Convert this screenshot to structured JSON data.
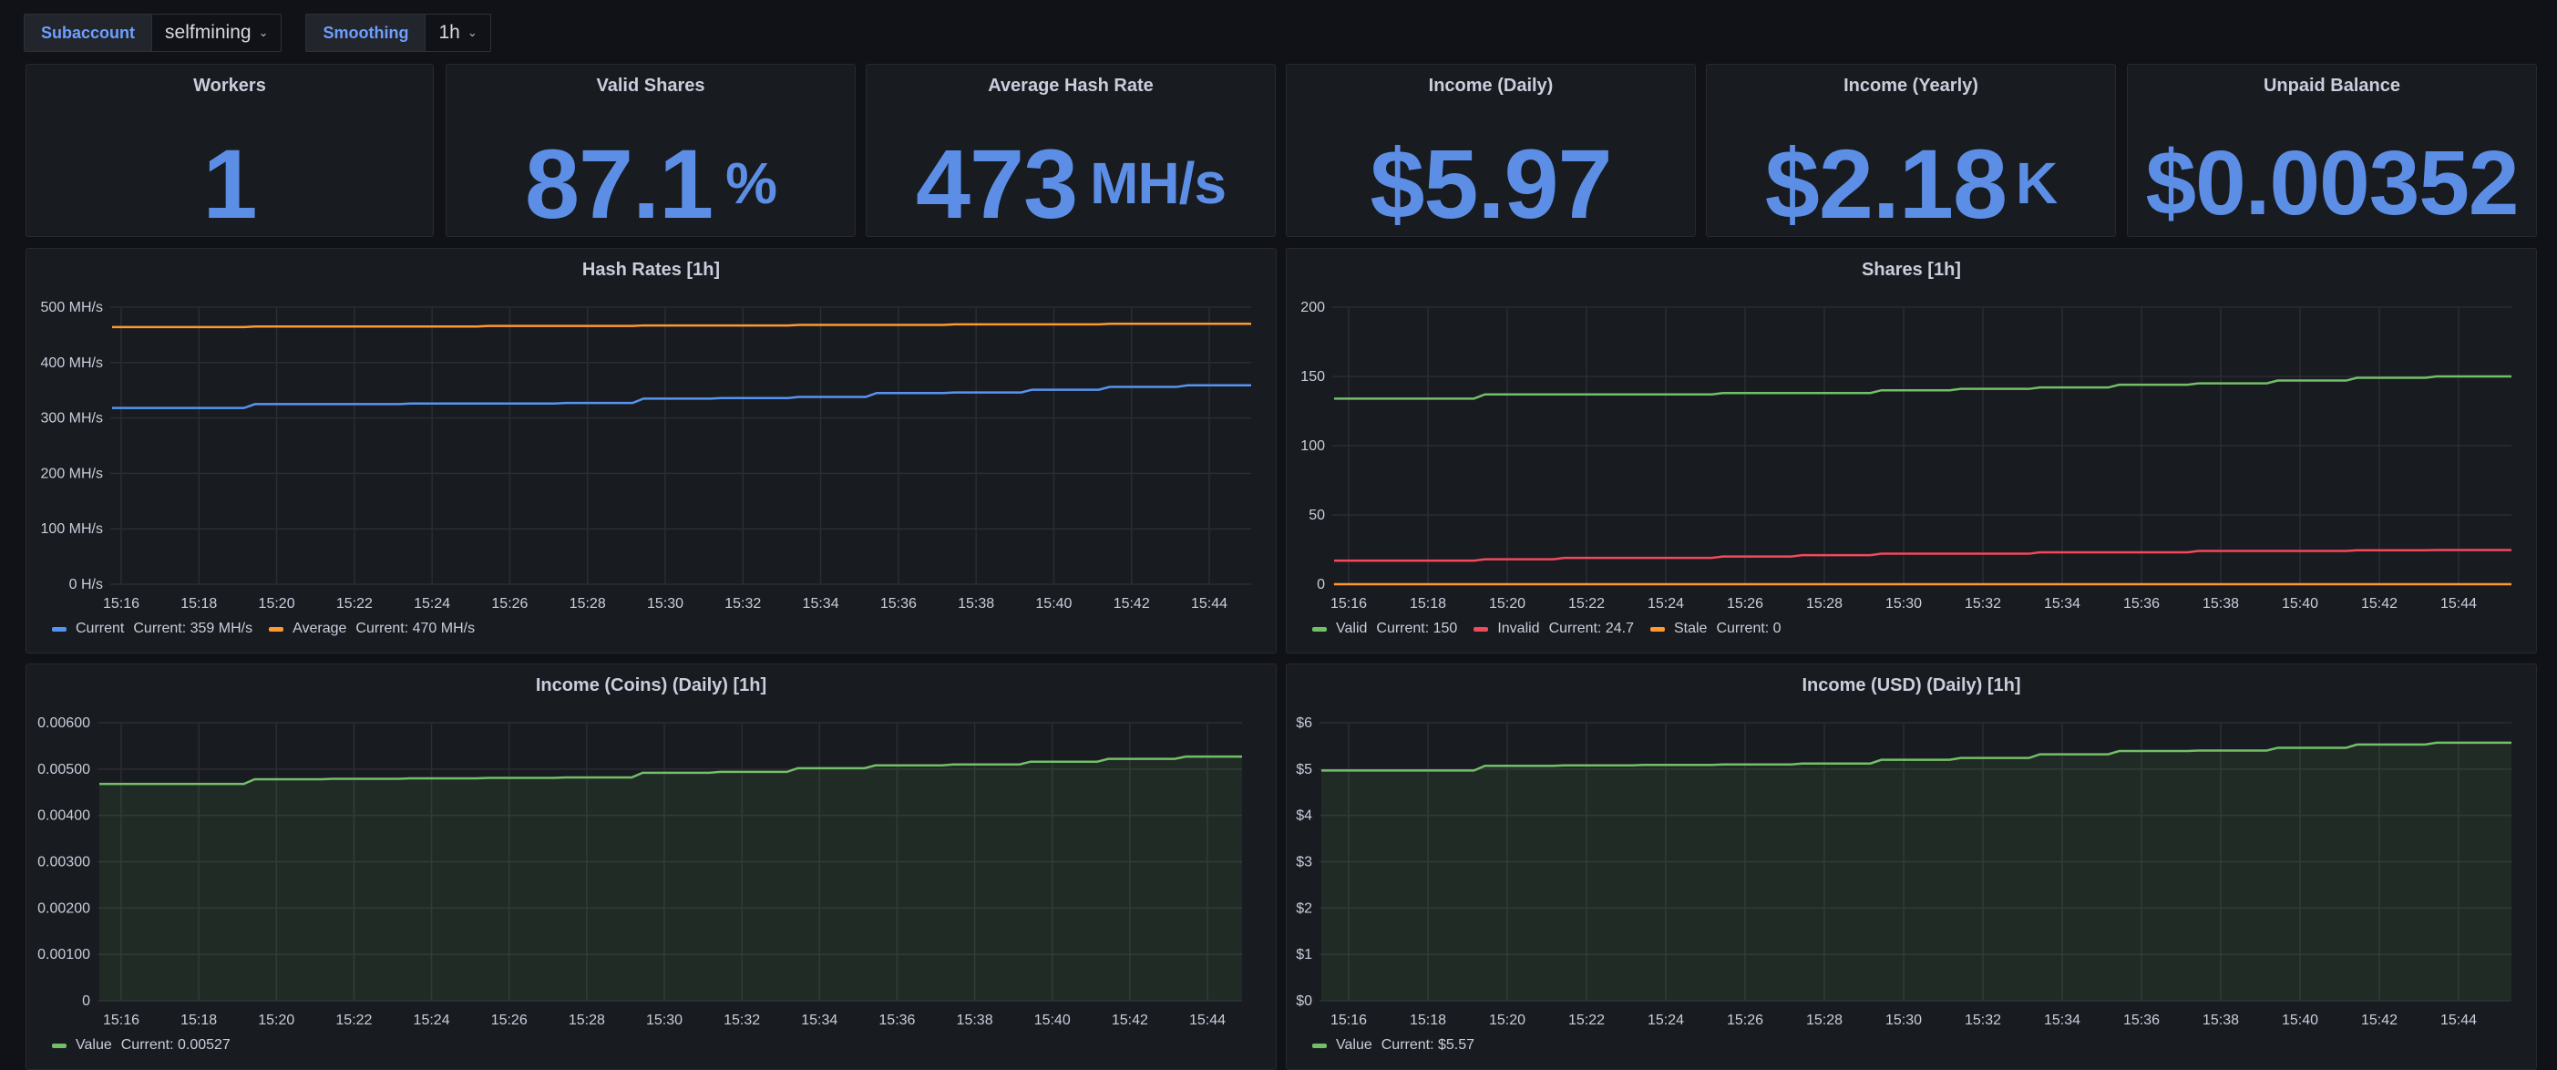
{
  "variables": [
    {
      "label": "Subaccount",
      "value": "selfmining"
    },
    {
      "label": "Smoothing",
      "value": "1h"
    }
  ],
  "stats": [
    {
      "title": "Workers",
      "value": "1",
      "unit": ""
    },
    {
      "title": "Valid Shares",
      "value": "87.1",
      "unit": "%"
    },
    {
      "title": "Average Hash Rate",
      "value": "473",
      "unit": "MH/s"
    },
    {
      "title": "Income (Daily)",
      "value": "$5.97",
      "unit": ""
    },
    {
      "title": "Income (Yearly)",
      "value": "$2.18",
      "unit": "K"
    },
    {
      "title": "Unpaid Balance",
      "value": "$0.00352",
      "unit": ""
    }
  ],
  "colors": {
    "blue": "#5794f2",
    "orange": "#ff9830",
    "green": "#73bf69",
    "red": "#f2495c",
    "stat": "#5c8ee6"
  },
  "chart_data": [
    {
      "type": "line",
      "title": "Hash Rates [1h]",
      "x": [
        "15:16",
        "15:18",
        "15:20",
        "15:22",
        "15:24",
        "15:26",
        "15:28",
        "15:30",
        "15:32",
        "15:34",
        "15:36",
        "15:38",
        "15:40",
        "15:42",
        "15:44"
      ],
      "y_ticks": [
        "0 H/s",
        "100 MH/s",
        "200 MH/s",
        "300 MH/s",
        "400 MH/s",
        "500 MH/s"
      ],
      "ylim": [
        0,
        500
      ],
      "series": [
        {
          "name": "Current",
          "color": "#5794f2",
          "legend": "Current: 359 MH/s",
          "values": [
            318,
            318,
            325,
            325,
            326,
            326,
            327,
            335,
            336,
            338,
            345,
            346,
            351,
            356,
            359
          ]
        },
        {
          "name": "Average",
          "color": "#ff9830",
          "legend": "Current: 470 MH/s",
          "values": [
            464,
            464,
            465,
            465,
            465,
            466,
            466,
            467,
            467,
            468,
            468,
            469,
            469,
            470,
            470
          ]
        }
      ]
    },
    {
      "type": "line",
      "title": "Shares [1h]",
      "x": [
        "15:16",
        "15:18",
        "15:20",
        "15:22",
        "15:24",
        "15:26",
        "15:28",
        "15:30",
        "15:32",
        "15:34",
        "15:36",
        "15:38",
        "15:40",
        "15:42",
        "15:44"
      ],
      "y_ticks": [
        "0",
        "50",
        "100",
        "150",
        "200"
      ],
      "ylim": [
        0,
        200
      ],
      "series": [
        {
          "name": "Valid",
          "color": "#73bf69",
          "legend": "Current: 150",
          "values": [
            134,
            134,
            137,
            137,
            137,
            138,
            138,
            140,
            141,
            142,
            144,
            145,
            147,
            149,
            150
          ]
        },
        {
          "name": "Invalid",
          "color": "#f2495c",
          "legend": "Current: 24.7",
          "values": [
            17,
            17,
            18,
            19,
            19,
            20,
            21,
            22,
            22,
            23,
            23,
            24,
            24,
            24.5,
            24.7
          ]
        },
        {
          "name": "Stale",
          "color": "#ff9830",
          "legend": "Current: 0",
          "values": [
            0,
            0,
            0,
            0,
            0,
            0,
            0,
            0,
            0,
            0,
            0,
            0,
            0,
            0,
            0
          ]
        }
      ]
    },
    {
      "type": "area",
      "title": "Income (Coins) (Daily) [1h]",
      "x": [
        "15:16",
        "15:18",
        "15:20",
        "15:22",
        "15:24",
        "15:26",
        "15:28",
        "15:30",
        "15:32",
        "15:34",
        "15:36",
        "15:38",
        "15:40",
        "15:42",
        "15:44"
      ],
      "y_ticks": [
        "0",
        "0.00100",
        "0.00200",
        "0.00300",
        "0.00400",
        "0.00500",
        "0.00600"
      ],
      "ylim": [
        0,
        0.006
      ],
      "series": [
        {
          "name": "Value",
          "color": "#73bf69",
          "legend": "Current: 0.00527",
          "values": [
            0.00468,
            0.00468,
            0.00478,
            0.00479,
            0.0048,
            0.00481,
            0.00482,
            0.00492,
            0.00494,
            0.00502,
            0.00508,
            0.0051,
            0.00516,
            0.00522,
            0.00527
          ]
        }
      ]
    },
    {
      "type": "area",
      "title": "Income (USD) (Daily) [1h]",
      "x": [
        "15:16",
        "15:18",
        "15:20",
        "15:22",
        "15:24",
        "15:26",
        "15:28",
        "15:30",
        "15:32",
        "15:34",
        "15:36",
        "15:38",
        "15:40",
        "15:42",
        "15:44"
      ],
      "y_ticks": [
        "$0",
        "$1",
        "$2",
        "$3",
        "$4",
        "$5",
        "$6"
      ],
      "ylim": [
        0,
        6
      ],
      "series": [
        {
          "name": "Value",
          "color": "#73bf69",
          "legend": "Current: $5.57",
          "values": [
            4.97,
            4.97,
            5.07,
            5.08,
            5.09,
            5.1,
            5.12,
            5.2,
            5.24,
            5.32,
            5.39,
            5.4,
            5.46,
            5.53,
            5.57
          ]
        }
      ]
    }
  ]
}
